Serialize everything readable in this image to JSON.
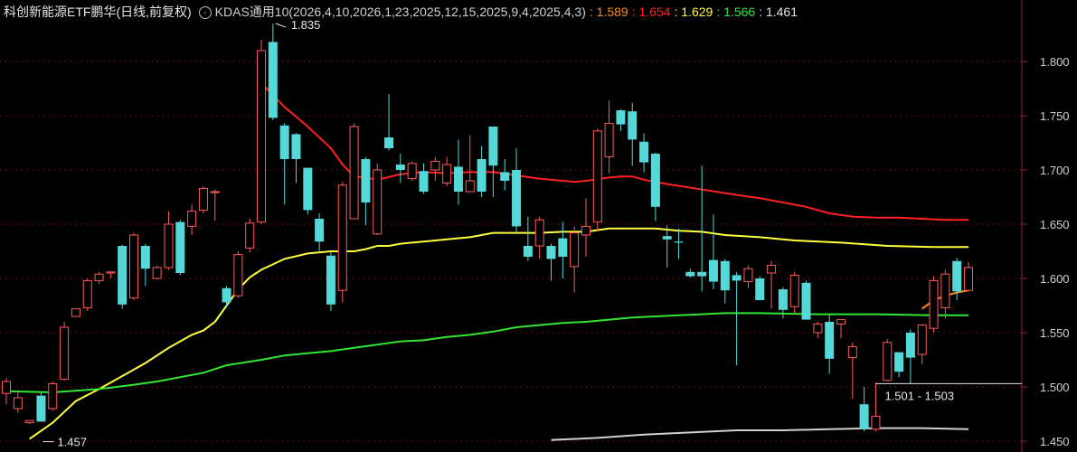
{
  "header": {
    "title": "科创新能源ETF鹏华(日线,前复权)",
    "icon": "settings-circle-icon",
    "indicator": "KDAS通用10(2026,4,10,2026,1,23,2025,12,15,2025,9,4,2025,4,3)",
    "values": [
      {
        "text": ": 1.589",
        "color": "#ff8c1a"
      },
      {
        "text": ": 1.654",
        "color": "#ff2020"
      },
      {
        "text": ": 1.629",
        "color": "#ffff3c"
      },
      {
        "text": ": 1.566",
        "color": "#33e633"
      },
      {
        "text": ": 1.461",
        "color": "#e6e6e6"
      }
    ]
  },
  "chart_data": {
    "type": "candlestick",
    "ylim": [
      1.44,
      1.84
    ],
    "y_ticks": [
      "1.800",
      "1.750",
      "1.700",
      "1.650",
      "1.600",
      "1.550",
      "1.500",
      "1.450"
    ],
    "candles": [
      [
        1.494,
        1.505,
        1.484,
        1.508
      ],
      [
        1.48,
        1.49,
        1.476,
        1.497
      ],
      [
        1.467,
        1.469,
        1.466,
        1.469
      ],
      [
        1.492,
        1.468,
        1.468,
        1.495
      ],
      [
        1.48,
        1.503,
        1.478,
        1.505
      ],
      [
        1.507,
        1.555,
        1.506,
        1.56
      ],
      [
        1.565,
        1.572,
        1.565,
        1.572
      ],
      [
        1.573,
        1.598,
        1.57,
        1.6
      ],
      [
        1.598,
        1.604,
        1.595,
        1.606
      ],
      [
        1.605,
        1.606,
        1.6,
        1.606
      ],
      [
        1.63,
        1.576,
        1.572,
        1.631
      ],
      [
        1.582,
        1.64,
        1.58,
        1.642
      ],
      [
        1.63,
        1.609,
        1.593,
        1.632
      ],
      [
        1.6,
        1.61,
        1.599,
        1.612
      ],
      [
        1.61,
        1.65,
        1.608,
        1.662
      ],
      [
        1.652,
        1.605,
        1.603,
        1.654
      ],
      [
        1.648,
        1.662,
        1.64,
        1.668
      ],
      [
        1.663,
        1.683,
        1.66,
        1.685
      ],
      [
        1.68,
        1.68,
        1.653,
        1.682
      ],
      [
        1.591,
        1.578,
        1.573,
        1.593
      ],
      [
        1.584,
        1.622,
        1.582,
        1.625
      ],
      [
        1.628,
        1.651,
        1.624,
        1.655
      ],
      [
        1.652,
        1.81,
        1.65,
        1.82
      ],
      [
        1.818,
        1.748,
        1.746,
        1.835
      ],
      [
        1.741,
        1.71,
        1.668,
        1.743
      ],
      [
        1.733,
        1.71,
        1.688,
        1.734
      ],
      [
        1.702,
        1.663,
        1.659,
        1.702
      ],
      [
        1.655,
        1.634,
        1.624,
        1.66
      ],
      [
        1.621,
        1.576,
        1.57,
        1.624
      ],
      [
        1.589,
        1.686,
        1.578,
        1.689
      ],
      [
        1.655,
        1.74,
        1.655,
        1.743
      ],
      [
        1.71,
        1.67,
        1.649,
        1.712
      ],
      [
        1.641,
        1.7,
        1.64,
        1.706
      ],
      [
        1.73,
        1.72,
        1.718,
        1.77
      ],
      [
        1.705,
        1.7,
        1.688,
        1.715
      ],
      [
        1.692,
        1.706,
        1.69,
        1.708
      ],
      [
        1.699,
        1.68,
        1.678,
        1.706
      ],
      [
        1.7,
        1.708,
        1.69,
        1.712
      ],
      [
        1.688,
        1.705,
        1.685,
        1.712
      ],
      [
        1.703,
        1.68,
        1.668,
        1.728
      ],
      [
        1.68,
        1.69,
        1.683,
        1.732
      ],
      [
        1.71,
        1.68,
        1.675,
        1.722
      ],
      [
        1.74,
        1.704,
        1.675,
        1.74
      ],
      [
        1.698,
        1.69,
        1.681,
        1.71
      ],
      [
        1.7,
        1.648,
        1.642,
        1.72
      ],
      [
        1.63,
        1.62,
        1.616,
        1.657
      ],
      [
        1.63,
        1.654,
        1.618,
        1.657
      ],
      [
        1.63,
        1.618,
        1.598,
        1.632
      ],
      [
        1.637,
        1.62,
        1.6,
        1.652
      ],
      [
        1.611,
        1.642,
        1.587,
        1.648
      ],
      [
        1.64,
        1.648,
        1.62,
        1.674
      ],
      [
        1.652,
        1.736,
        1.644,
        1.738
      ],
      [
        1.712,
        1.743,
        1.697,
        1.764
      ],
      [
        1.755,
        1.742,
        1.736,
        1.756
      ],
      [
        1.754,
        1.728,
        1.704,
        1.762
      ],
      [
        1.726,
        1.707,
        1.698,
        1.734
      ],
      [
        1.715,
        1.666,
        1.653,
        1.716
      ],
      [
        1.639,
        1.636,
        1.61,
        1.649
      ],
      [
        1.634,
        1.633,
        1.618,
        1.646
      ],
      [
        1.606,
        1.602,
        1.601,
        1.609
      ],
      [
        1.606,
        1.602,
        1.588,
        1.704
      ],
      [
        1.617,
        1.597,
        1.59,
        1.659
      ],
      [
        1.616,
        1.589,
        1.577,
        1.618
      ],
      [
        1.603,
        1.598,
        1.52,
        1.606
      ],
      [
        1.597,
        1.609,
        1.591,
        1.612
      ],
      [
        1.6,
        1.58,
        1.58,
        1.602
      ],
      [
        1.605,
        1.612,
        1.572,
        1.616
      ],
      [
        1.59,
        1.571,
        1.563,
        1.592
      ],
      [
        1.574,
        1.603,
        1.568,
        1.606
      ],
      [
        1.596,
        1.562,
        1.567,
        1.598
      ],
      [
        1.55,
        1.558,
        1.545,
        1.56
      ],
      [
        1.56,
        1.526,
        1.512,
        1.566
      ],
      [
        1.558,
        1.562,
        1.545,
        1.562
      ],
      [
        1.527,
        1.537,
        1.489,
        1.541
      ],
      [
        1.484,
        1.461,
        1.459,
        1.5
      ],
      [
        1.461,
        1.473,
        1.459,
        1.504
      ],
      [
        1.506,
        1.541,
        1.505,
        1.544
      ],
      [
        1.532,
        1.514,
        1.509,
        1.532
      ],
      [
        1.55,
        1.527,
        1.503,
        1.553
      ],
      [
        1.53,
        1.557,
        1.521,
        1.558
      ],
      [
        1.554,
        1.598,
        1.55,
        1.602
      ],
      [
        1.573,
        1.604,
        1.563,
        1.608
      ],
      [
        1.616,
        1.588,
        1.58,
        1.619
      ],
      [
        1.589,
        1.61,
        1.588,
        1.615
      ]
    ],
    "series": [
      {
        "color": "#ff8c1a",
        "points": [
          [
            79,
            1.572
          ],
          [
            80,
            1.58
          ],
          [
            81,
            1.584
          ],
          [
            82,
            1.587
          ],
          [
            83,
            1.589
          ]
        ]
      },
      {
        "color": "#ff2020",
        "points": [
          [
            22,
            1.78
          ],
          [
            24,
            1.758
          ],
          [
            26,
            1.74
          ],
          [
            28,
            1.72
          ],
          [
            29,
            1.705
          ],
          [
            30,
            1.694
          ],
          [
            31,
            1.693
          ],
          [
            32,
            1.691
          ],
          [
            34,
            1.696
          ],
          [
            36,
            1.698
          ],
          [
            38,
            1.697
          ],
          [
            40,
            1.698
          ],
          [
            42,
            1.698
          ],
          [
            44,
            1.695
          ],
          [
            46,
            1.692
          ],
          [
            48,
            1.69
          ],
          [
            49,
            1.689
          ],
          [
            50,
            1.69
          ],
          [
            52,
            1.693
          ],
          [
            53,
            1.694
          ],
          [
            54,
            1.694
          ],
          [
            55,
            1.691
          ],
          [
            57,
            1.687
          ],
          [
            60,
            1.682
          ],
          [
            63,
            1.677
          ],
          [
            65,
            1.674
          ],
          [
            67,
            1.67
          ],
          [
            69,
            1.666
          ],
          [
            71,
            1.66
          ],
          [
            73,
            1.657
          ],
          [
            75,
            1.656
          ],
          [
            77,
            1.656
          ],
          [
            79,
            1.655
          ],
          [
            81,
            1.654
          ],
          [
            83,
            1.654
          ]
        ]
      },
      {
        "color": "#ffff3c",
        "points": [
          [
            2,
            1.452
          ],
          [
            4,
            1.467
          ],
          [
            6,
            1.487
          ],
          [
            8,
            1.498
          ],
          [
            10,
            1.51
          ],
          [
            12,
            1.522
          ],
          [
            14,
            1.536
          ],
          [
            15,
            1.542
          ],
          [
            16,
            1.548
          ],
          [
            17,
            1.552
          ],
          [
            18,
            1.56
          ],
          [
            19,
            1.575
          ],
          [
            20,
            1.59
          ],
          [
            21,
            1.601
          ],
          [
            22,
            1.608
          ],
          [
            24,
            1.618
          ],
          [
            26,
            1.623
          ],
          [
            28,
            1.625
          ],
          [
            30,
            1.625
          ],
          [
            31,
            1.627
          ],
          [
            32,
            1.63
          ],
          [
            33,
            1.63
          ],
          [
            34,
            1.632
          ],
          [
            35,
            1.633
          ],
          [
            36,
            1.634
          ],
          [
            38,
            1.636
          ],
          [
            40,
            1.638
          ],
          [
            42,
            1.642
          ],
          [
            44,
            1.642
          ],
          [
            46,
            1.642
          ],
          [
            48,
            1.643
          ],
          [
            50,
            1.643
          ],
          [
            52,
            1.646
          ],
          [
            53,
            1.646
          ],
          [
            54,
            1.646
          ],
          [
            55,
            1.646
          ],
          [
            56,
            1.646
          ],
          [
            57,
            1.645
          ],
          [
            58,
            1.644
          ],
          [
            60,
            1.643
          ],
          [
            62,
            1.64
          ],
          [
            65,
            1.638
          ],
          [
            68,
            1.635
          ],
          [
            72,
            1.633
          ],
          [
            76,
            1.63
          ],
          [
            80,
            1.629
          ],
          [
            83,
            1.629
          ]
        ]
      },
      {
        "color": "#33e633",
        "points": [
          [
            0,
            1.496
          ],
          [
            4,
            1.495
          ],
          [
            8,
            1.498
          ],
          [
            11,
            1.502
          ],
          [
            13,
            1.505
          ],
          [
            15,
            1.509
          ],
          [
            17,
            1.513
          ],
          [
            19,
            1.52
          ],
          [
            22,
            1.525
          ],
          [
            24,
            1.529
          ],
          [
            26,
            1.531
          ],
          [
            28,
            1.533
          ],
          [
            30,
            1.536
          ],
          [
            32,
            1.539
          ],
          [
            34,
            1.542
          ],
          [
            36,
            1.543
          ],
          [
            38,
            1.546
          ],
          [
            40,
            1.548
          ],
          [
            42,
            1.551
          ],
          [
            44,
            1.555
          ],
          [
            46,
            1.557
          ],
          [
            48,
            1.559
          ],
          [
            50,
            1.56
          ],
          [
            52,
            1.562
          ],
          [
            54,
            1.564
          ],
          [
            56,
            1.565
          ],
          [
            58,
            1.566
          ],
          [
            60,
            1.567
          ],
          [
            62,
            1.568
          ],
          [
            65,
            1.568
          ],
          [
            70,
            1.567
          ],
          [
            75,
            1.567
          ],
          [
            80,
            1.566
          ],
          [
            83,
            1.566
          ]
        ]
      },
      {
        "color": "#d0d0d0",
        "points": [
          [
            47,
            1.451
          ],
          [
            51,
            1.453
          ],
          [
            55,
            1.456
          ],
          [
            59,
            1.458
          ],
          [
            63,
            1.46
          ],
          [
            67,
            1.46
          ],
          [
            71,
            1.461
          ],
          [
            75,
            1.462
          ],
          [
            79,
            1.462
          ],
          [
            83,
            1.461
          ]
        ]
      }
    ],
    "annotations": [
      {
        "text": "1.835",
        "index": 23,
        "value": 1.835
      },
      {
        "text": "1.457",
        "index": 3,
        "value": 1.457
      },
      {
        "text": "1.501 - 1.503",
        "index": 75,
        "value": 1.503
      }
    ],
    "ref_line": {
      "value": 1.503,
      "from_index": 75
    }
  },
  "theme": {
    "up": "#ff5a5a",
    "down": "#54d8d8",
    "grid": "#8a2a2a",
    "axis_text": "#d0d0d0"
  }
}
